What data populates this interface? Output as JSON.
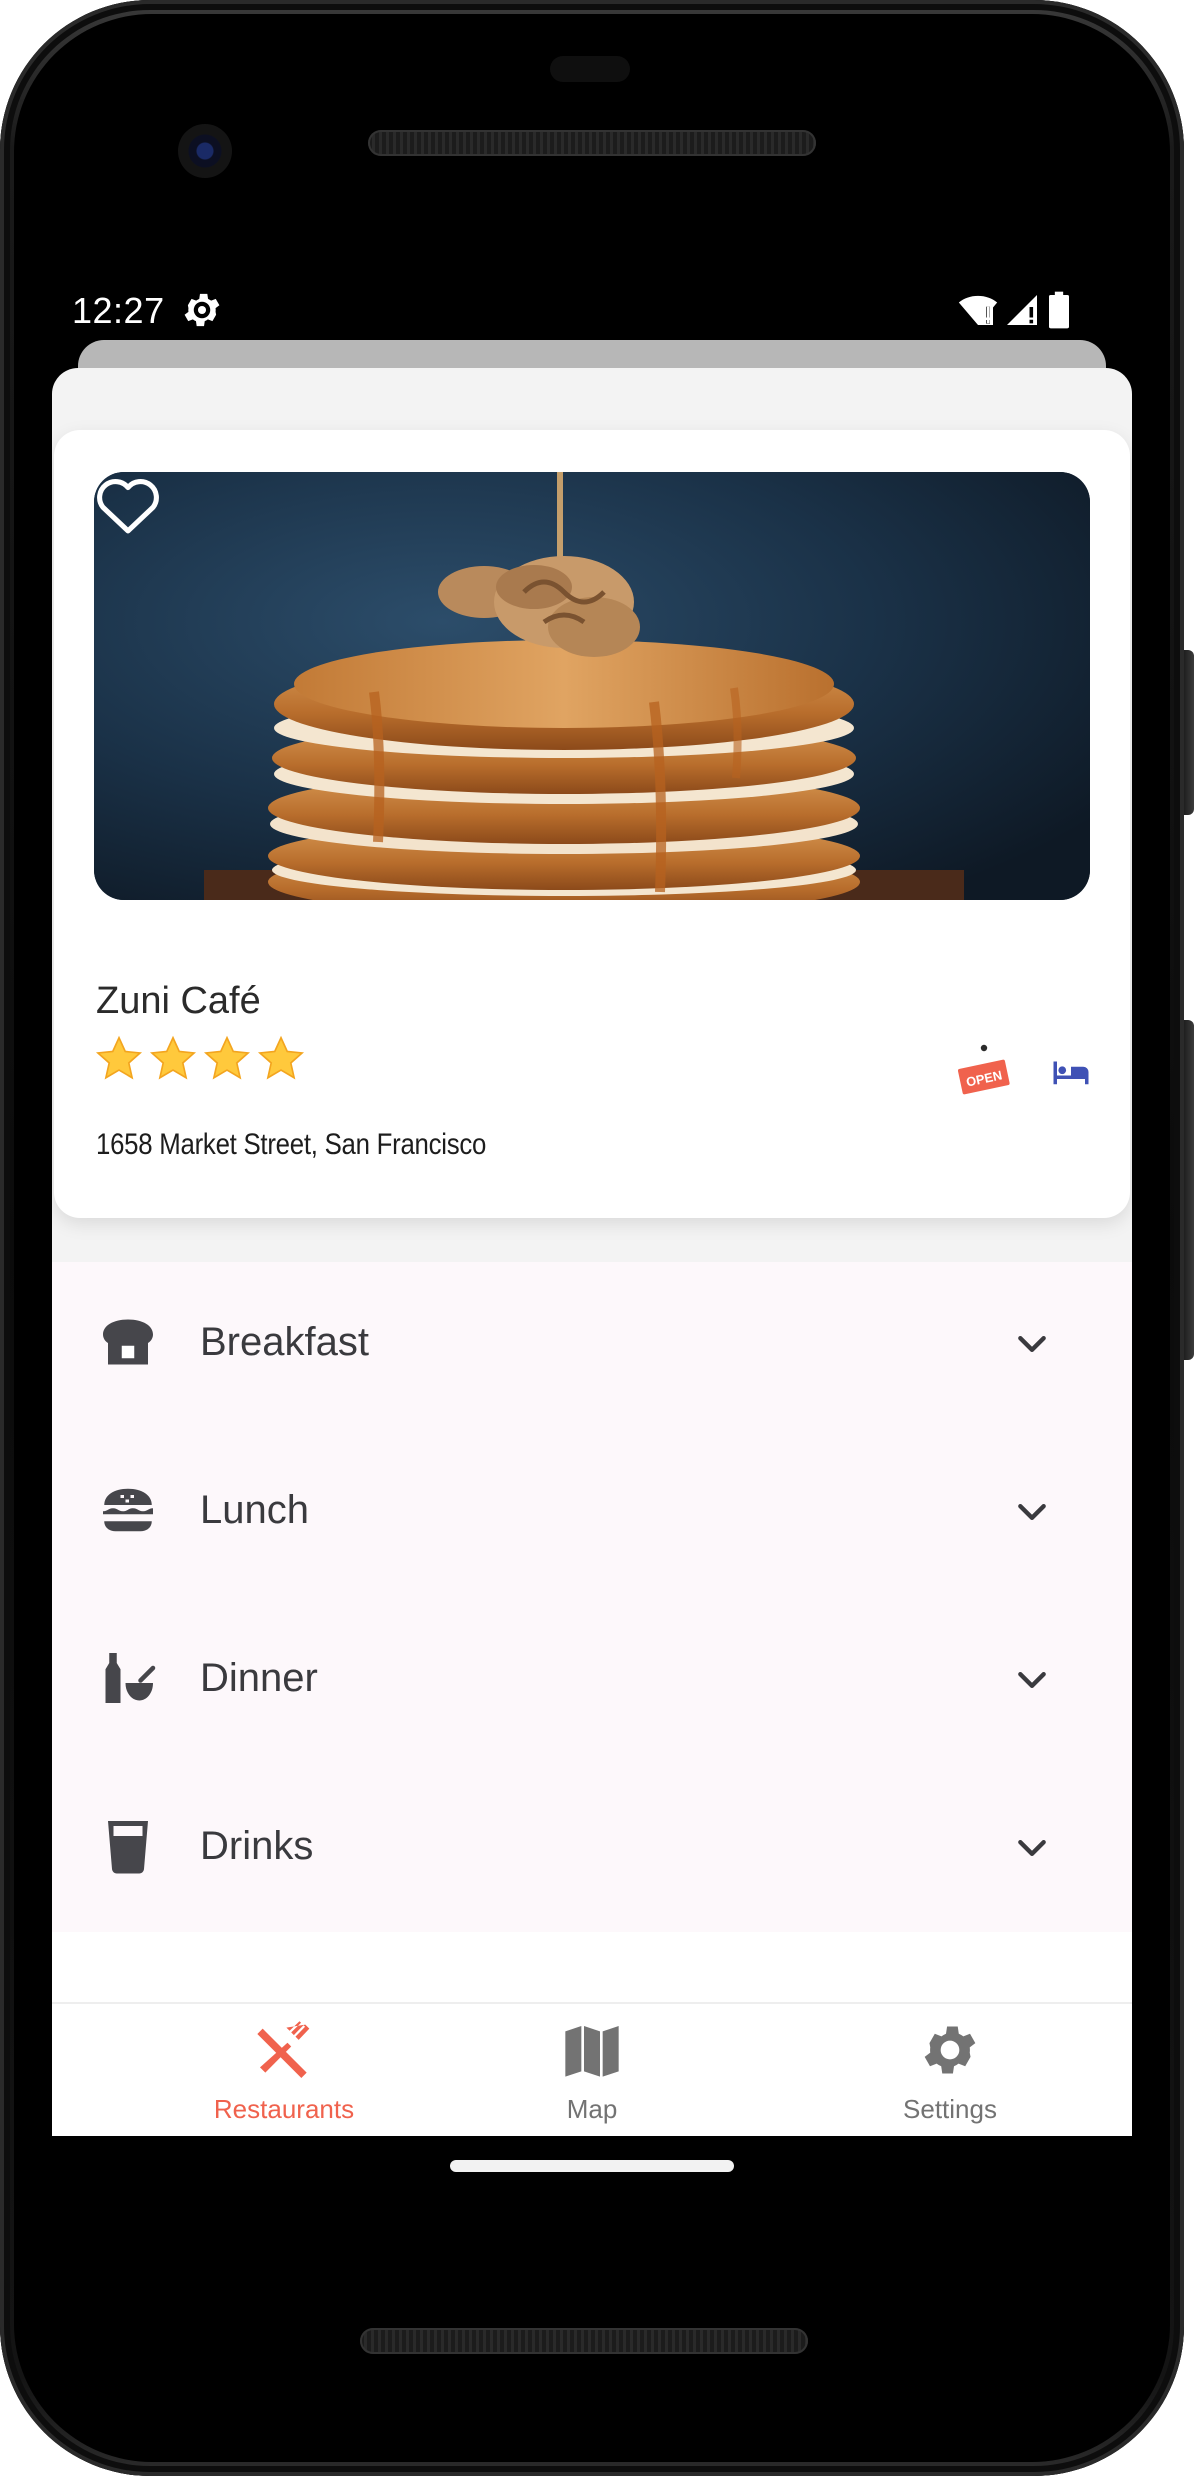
{
  "status_bar": {
    "time": "12:27",
    "icons": [
      "settings-icon",
      "wifi-alert-icon",
      "signal-alert-icon",
      "battery-icon"
    ]
  },
  "restaurant": {
    "name": "Zuni Café",
    "rating": 4,
    "rating_max": 4,
    "address": "1658 Market Street, San Francisco",
    "favorite_icon": "heart-outline-icon",
    "badges": [
      {
        "icon": "open-sign-icon",
        "label": "OPEN",
        "color": "#f0624d"
      },
      {
        "icon": "bed-icon",
        "color": "#3f51b5"
      }
    ],
    "image": "pancake-stack-photo"
  },
  "menu": {
    "sections": [
      {
        "label": "Breakfast",
        "icon": "bread-icon"
      },
      {
        "label": "Lunch",
        "icon": "burger-icon"
      },
      {
        "label": "Dinner",
        "icon": "bottle-bowl-icon"
      },
      {
        "label": "Drinks",
        "icon": "glass-icon"
      }
    ],
    "expand_icon": "chevron-down-icon"
  },
  "bottom_nav": {
    "items": [
      {
        "label": "Restaurants",
        "icon": "fork-knife-icon",
        "active": true
      },
      {
        "label": "Map",
        "icon": "map-icon",
        "active": false
      },
      {
        "label": "Settings",
        "icon": "gear-icon",
        "active": false
      }
    ],
    "active_color": "#f0624d",
    "inactive_color": "#737373"
  },
  "colors": {
    "accent": "#f0624d",
    "star": "#ffc93c",
    "icon_dark": "#46464b",
    "menu_bg": "#fdf8fb"
  }
}
